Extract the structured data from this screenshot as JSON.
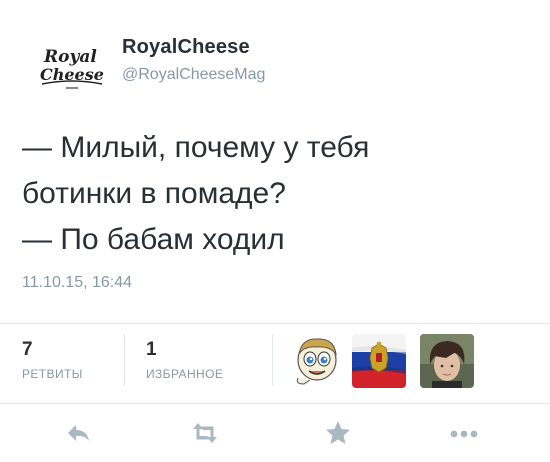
{
  "author": {
    "name": "RoyalCheese",
    "handle": "@RoyalCheeseMag",
    "logo_lines": [
      "Royal",
      "Cheese"
    ]
  },
  "tweet": {
    "lines": [
      "— Милый, почему у тебя",
      "ботинки в помаде?",
      "— По бабам ходил"
    ],
    "timestamp": "11.10.15, 16:44"
  },
  "stats": {
    "retweets": {
      "count": "7",
      "label": "РЕТВИТЫ"
    },
    "favorites": {
      "count": "1",
      "label": "ИЗБРАННОЕ"
    }
  },
  "avatars": [
    {
      "icon": "meme-face-avatar"
    },
    {
      "icon": "russian-flag-avatar"
    },
    {
      "icon": "user-photo-avatar"
    }
  ],
  "actions": [
    {
      "icon": "reply-icon"
    },
    {
      "icon": "retweet-icon"
    },
    {
      "icon": "favorite-star-icon"
    },
    {
      "icon": "more-dots-icon"
    }
  ],
  "colors": {
    "text": "#292f33",
    "muted": "#8899a6",
    "divider": "#e1e8ed",
    "action_icon": "#aab8c2"
  }
}
